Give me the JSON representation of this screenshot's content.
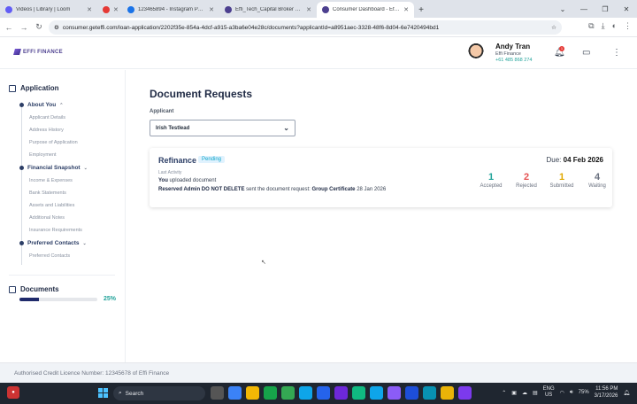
{
  "browser": {
    "tabs": [
      {
        "title": "Videos | Library | Loom",
        "color": "#625df5"
      },
      {
        "title": "",
        "color": "#e53935"
      },
      {
        "title": "123465894 - Instagram Post (4...",
        "color": "#1a73e8"
      },
      {
        "title": "Effi_Tech_Capital Broker Portal",
        "color": "#4c3f8f"
      },
      {
        "title": "Consumer Dashboard - Effi Fina...",
        "color": "#4c3f8f",
        "active": true
      }
    ],
    "url": "consumer.geteffi.com/loan-application/2202f35e-854a-4dcf-a915-a3ba6e04e28c/documents?applicantId=a8951aec-3328-48f6-8d04-6e7420494bd1"
  },
  "header": {
    "logo_text": "EFFI FINANCE",
    "user_name": "Andy Tran",
    "user_org": "Effi Finance",
    "user_phone": "+61 485 868 274",
    "notification_count": "1"
  },
  "sidebar": {
    "application_title": "Application",
    "groups": [
      {
        "label": "About You",
        "items": [
          "Applicant Details",
          "Address History",
          "Purpose of Application",
          "Employment"
        ]
      },
      {
        "label": "Financial Snapshot",
        "items": [
          "Income & Expenses",
          "Bank Statements",
          "Assets and Liabilities",
          "Additional Notes",
          "Insurance Requirements"
        ]
      },
      {
        "label": "Preferred Contacts",
        "items": [
          "Preferred Contacts"
        ]
      }
    ],
    "documents_title": "Documents",
    "documents_progress": 25,
    "documents_progress_label": "25%"
  },
  "main": {
    "title": "Document Requests",
    "applicant_label": "Applicant",
    "applicant_value": "Irish Testlead",
    "card": {
      "type": "Refinance",
      "status": "Pending",
      "last_activity_label": "Last Activity",
      "activity_actor": "You",
      "activity_text": " uploaded document",
      "request_actor": "Reserved Admin DO NOT DELETE",
      "request_text": " sent the document request: ",
      "request_doc": "Group Certificate",
      "request_date": " 28 Jan 2026",
      "due_label": "Due: ",
      "due_date": "04 Feb 2026",
      "stats": [
        {
          "value": "1",
          "label": "Accepted",
          "color": "#22a39a"
        },
        {
          "value": "2",
          "label": "Rejected",
          "color": "#e55353"
        },
        {
          "value": "1",
          "label": "Submitted",
          "color": "#e0a800"
        },
        {
          "value": "4",
          "label": "Waiting",
          "color": "#6b7280"
        }
      ]
    }
  },
  "footer": {
    "text": "Authorised Credit Licence Number: 12345678 of Effi Finance"
  },
  "taskbar": {
    "search_placeholder": "Search",
    "lang": "ENG",
    "region": "US",
    "battery": "75%",
    "time": "11:56 PM",
    "date": "3/17/2026"
  }
}
